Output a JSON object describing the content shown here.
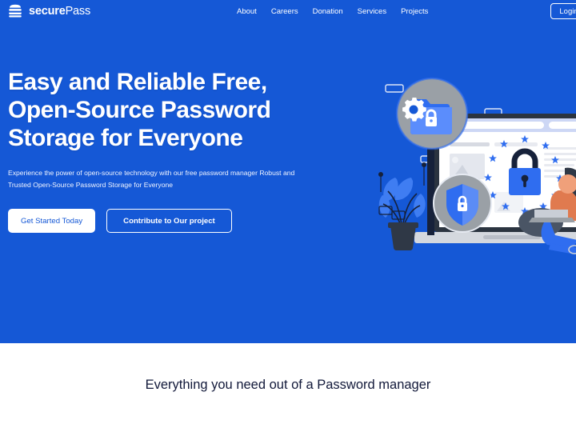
{
  "brand": {
    "name_bold": "secure",
    "name_light": "Pass",
    "logo_icon": "stacked-waves-icon"
  },
  "nav": {
    "links": [
      {
        "label": "About"
      },
      {
        "label": "Careers"
      },
      {
        "label": "Donation"
      },
      {
        "label": "Services"
      },
      {
        "label": "Projects"
      }
    ],
    "login_label": "Login"
  },
  "hero": {
    "title": "Easy and Reliable Free, Open-Source Password Storage for Everyone",
    "subtitle": "Experience the power of open-source technology with our free password manager Robust and Trusted Open-Source Password Storage for Everyone",
    "primary_button": "Get Started Today",
    "secondary_button": "Contribute to Our project",
    "background_color": "#1558d6",
    "illustration": {
      "name": "laptop-security-illustration",
      "elements": [
        "magnifier-with-locked-folder",
        "laptop-screen-browser-window",
        "padlock-surrounded-by-stars",
        "shield-with-lock-badge",
        "potted-plant",
        "gear-icon",
        "person-with-laptop"
      ]
    }
  },
  "features": {
    "heading": "Everything you need out of a Password manager",
    "background_color": "#ffffff",
    "heading_color": "#12193a"
  }
}
